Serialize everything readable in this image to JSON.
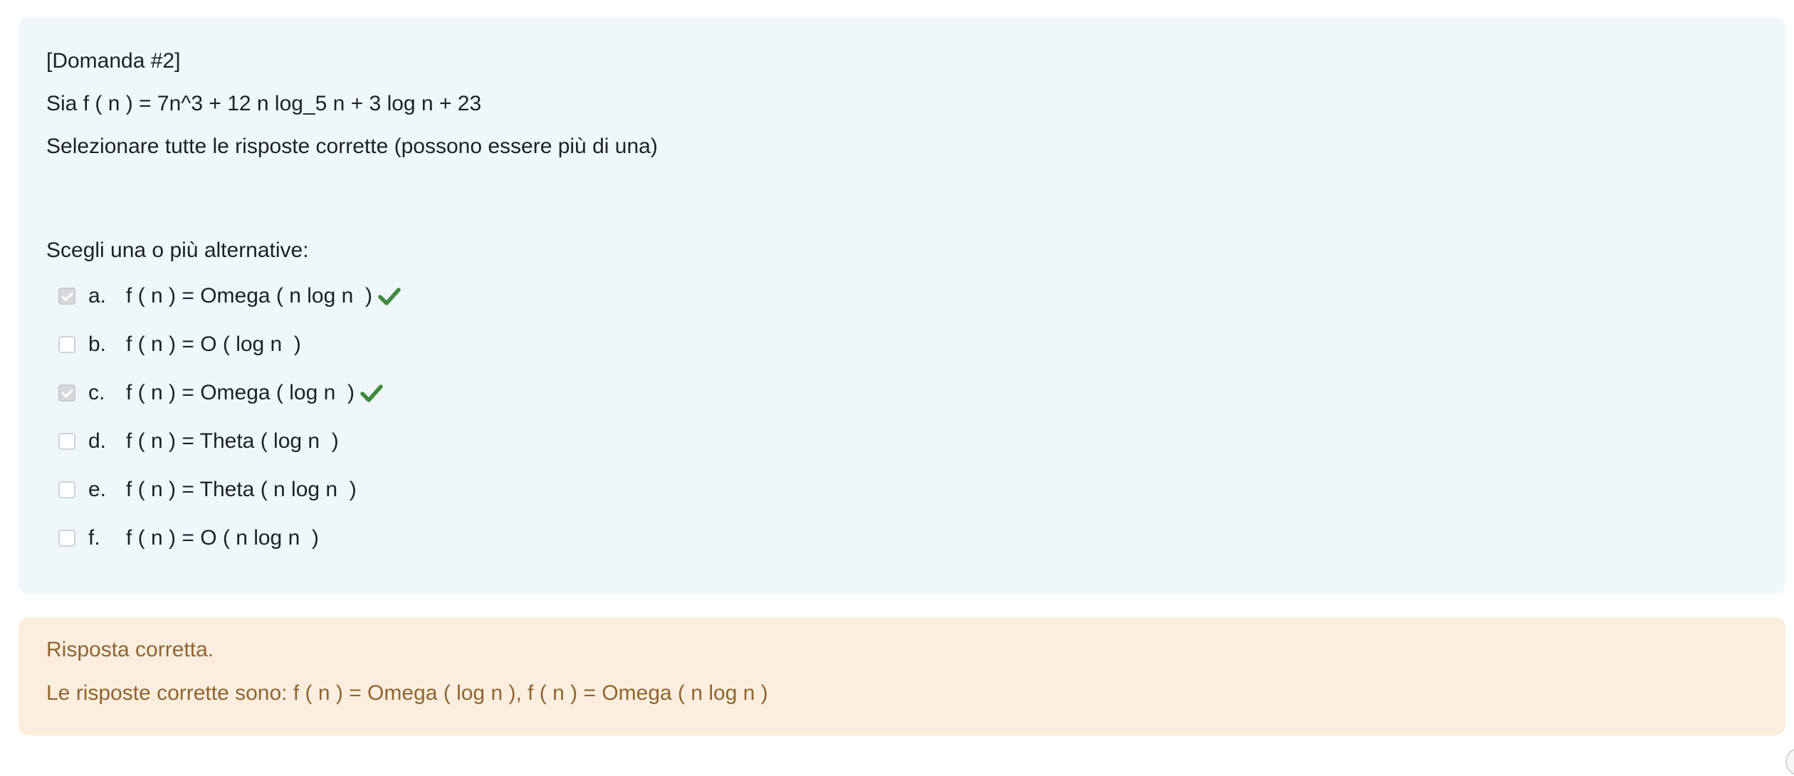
{
  "question": {
    "number_label": "[Domanda #2]",
    "statement": "Sia f ( n ) = 7n^3 + 12 n log_5 n + 3 log n + 23",
    "instruction": "Selezionare tutte le risposte corrette (possono essere più di una)",
    "prompt": "Scegli una o più alternative:",
    "options": [
      {
        "letter": "a.",
        "text": "f ( n ) = Omega ( n log n  )",
        "checked": true,
        "correct": true
      },
      {
        "letter": "b.",
        "text": "f ( n ) = O ( log n  )",
        "checked": false,
        "correct": false
      },
      {
        "letter": "c.",
        "text": "f ( n ) = Omega ( log n  )",
        "checked": true,
        "correct": true
      },
      {
        "letter": "d.",
        "text": "f ( n ) = Theta ( log n  )",
        "checked": false,
        "correct": false
      },
      {
        "letter": "e.",
        "text": "f ( n ) = Theta ( n log n  )",
        "checked": false,
        "correct": false
      },
      {
        "letter": "f.",
        "text": "f ( n ) = O ( n log n  )",
        "checked": false,
        "correct": false
      }
    ]
  },
  "feedback": {
    "status": "Risposta corretta.",
    "correct_answers": "Le risposte corrette sono: f ( n ) = Omega ( log n  ), f ( n ) = Omega ( n log n  )"
  },
  "colors": {
    "question_bg": "#eff7fb",
    "feedback_bg": "#fbeedf",
    "feedback_text": "#8e662e",
    "correct_tick": "#3f8b3e"
  },
  "icons": {
    "correct": "check-icon"
  }
}
